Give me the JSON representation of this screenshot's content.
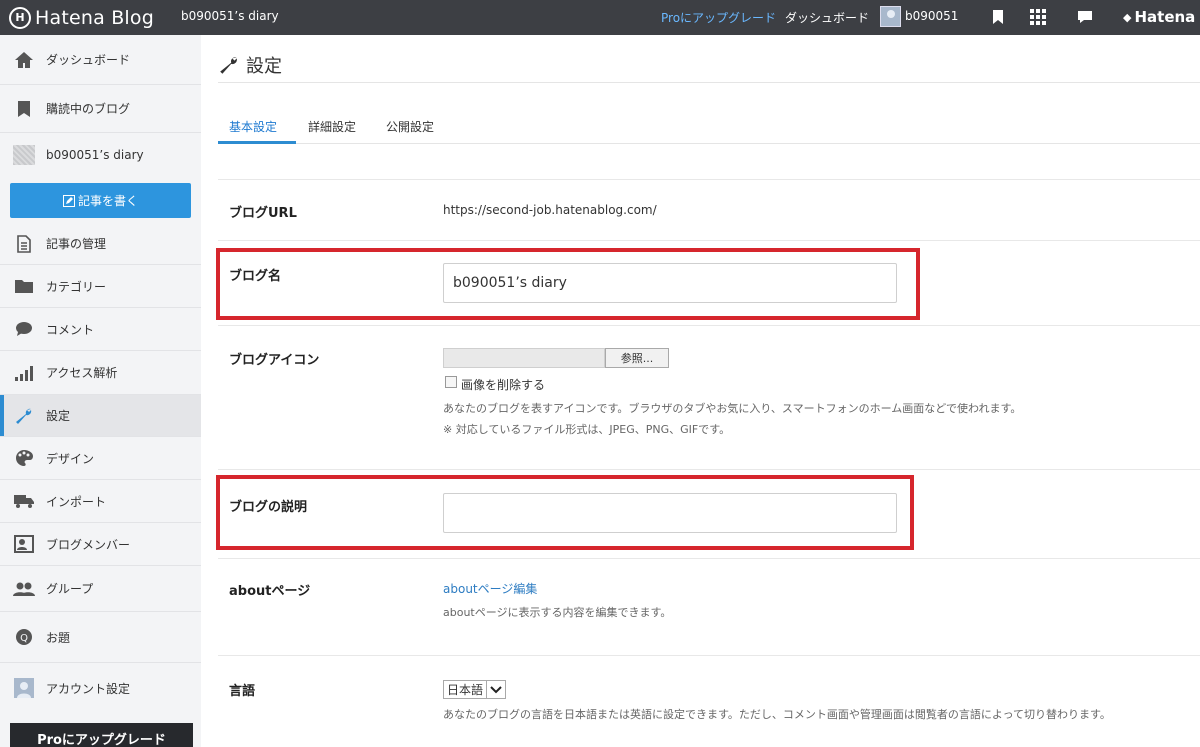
{
  "topbar": {
    "brand": "Hatena Blog",
    "blog_title": "b090051’s diary",
    "pro_upgrade": "Proにアップグレード",
    "dashboard": "ダッシュボード",
    "username": "b090051",
    "hatena": "Hatena"
  },
  "sidebar": {
    "items": [
      {
        "label": "ダッシュボード",
        "icon": "home-icon"
      },
      {
        "label": "購読中のブログ",
        "icon": "bookmark-icon"
      },
      {
        "label": "b090051’s diary",
        "icon": "blog-thumbnail"
      },
      {
        "label": "記事の管理",
        "icon": "document-icon"
      },
      {
        "label": "カテゴリー",
        "icon": "folder-icon"
      },
      {
        "label": "コメント",
        "icon": "comment-icon"
      },
      {
        "label": "アクセス解析",
        "icon": "bars-icon"
      },
      {
        "label": "設定",
        "icon": "wrench-icon"
      },
      {
        "label": "デザイン",
        "icon": "palette-icon"
      },
      {
        "label": "インポート",
        "icon": "truck-icon"
      },
      {
        "label": "ブログメンバー",
        "icon": "members-icon"
      },
      {
        "label": "グループ",
        "icon": "group-icon"
      },
      {
        "label": "お題",
        "icon": "theme-icon"
      },
      {
        "label": "アカウント設定",
        "icon": "account-icon"
      }
    ],
    "write_button": "記事を書く",
    "pro_button": "Proにアップグレード"
  },
  "main": {
    "title": "設定",
    "tabs": [
      "基本設定",
      "詳細設定",
      "公開設定"
    ],
    "active_tab": "基本設定",
    "blog_url": {
      "label": "ブログURL",
      "value": "https://second-job.hatenablog.com/"
    },
    "blog_name": {
      "label": "ブログ名",
      "value": "b090051’s diary"
    },
    "blog_icon": {
      "label": "ブログアイコン",
      "browse": "参照...",
      "delete_label": "画像を削除する",
      "help1": "あなたのブログを表すアイコンです。ブラウザのタブやお気に入り、スマートフォンのホーム画面などで使われます。",
      "help2": "※ 対応しているファイル形式は、JPEG、PNG、GIFです。"
    },
    "blog_description": {
      "label": "ブログの説明",
      "value": ""
    },
    "about_page": {
      "label": "aboutページ",
      "link": "aboutページ編集",
      "help": "aboutページに表示する内容を編集できます。"
    },
    "language": {
      "label": "言語",
      "value": "日本語",
      "help": "あなたのブログの言語を日本語または英語に設定できます。ただし、コメント画面や管理画面は閲覧者の言語によって切り替わります。"
    }
  },
  "colors": {
    "accent": "#2d8cd1",
    "highlight": "#d6262d",
    "topbar": "#3d3f44"
  }
}
